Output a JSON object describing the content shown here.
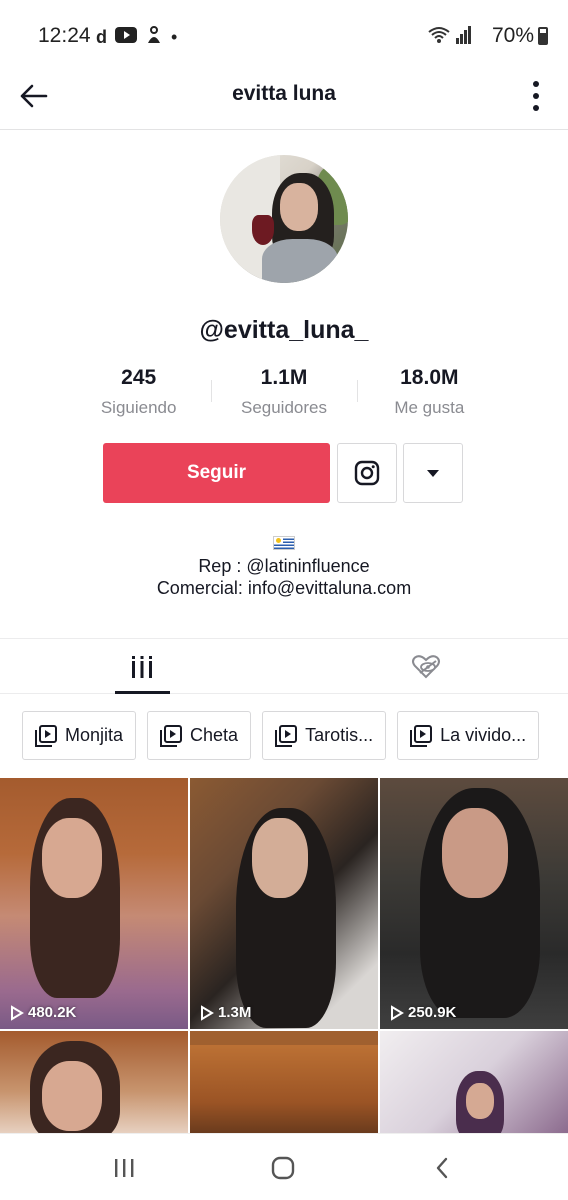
{
  "status_bar": {
    "time": "12:24",
    "battery": "70%",
    "notification_icons": [
      "d",
      "youtube-icon",
      "notification-icon",
      "•"
    ]
  },
  "header": {
    "title": "evitta luna"
  },
  "profile": {
    "handle": "@evitta_luna_",
    "stats": [
      {
        "value": "245",
        "label": "Siguiendo"
      },
      {
        "value": "1.1M",
        "label": "Seguidores"
      },
      {
        "value": "18.0M",
        "label": "Me gusta"
      }
    ],
    "follow_label": "Seguir",
    "bio_flag": "uruguay-flag-icon",
    "bio_lines": [
      "Rep : @latininfluence",
      "Comercial: info@evittaluna.com"
    ]
  },
  "tabs": [
    {
      "name": "videos-grid-icon",
      "active": true
    },
    {
      "name": "liked-videos-icon",
      "active": false
    }
  ],
  "playlists": [
    "Monjita",
    "Cheta",
    "Tarotis...",
    "La vivido..."
  ],
  "videos": [
    {
      "views": "480.2K"
    },
    {
      "views": "1.3M"
    },
    {
      "views": "250.9K"
    },
    {
      "views": ""
    },
    {
      "views": ""
    },
    {
      "views": ""
    }
  ],
  "colors": {
    "accent": "#ea4359",
    "text": "#161823",
    "muted": "#8a8b91"
  }
}
